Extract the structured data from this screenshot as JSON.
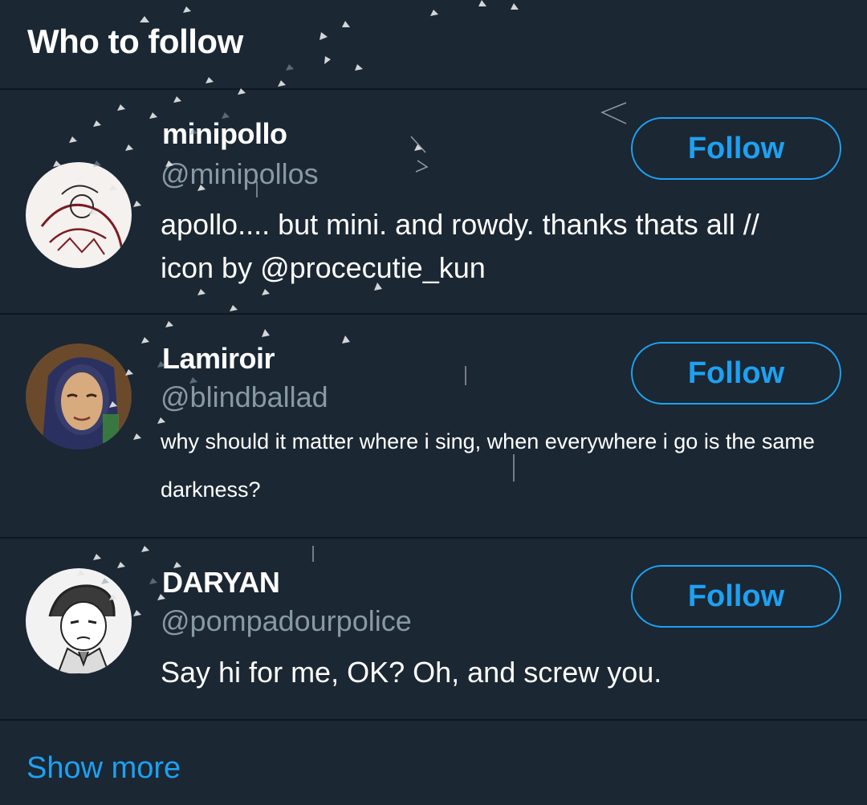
{
  "header": {
    "title": "Who to follow"
  },
  "accounts": [
    {
      "name": "minipollo",
      "handle": "@minipollos",
      "bio": "apollo.... but mini. and rowdy. thanks thats all // icon by @procecutie_kun",
      "follow_label": "Follow"
    },
    {
      "name": "Lamiroir",
      "handle": "@blindballad",
      "bio": "why should it matter where i sing, when everywhere i go is the same darkness?",
      "follow_label": "Follow"
    },
    {
      "name": "DARYAN",
      "handle": "@pompadourpolice",
      "bio": "Say hi for me, OK? Oh, and screw you.",
      "follow_label": "Follow"
    }
  ],
  "footer": {
    "show_more_label": "Show more"
  },
  "colors": {
    "background": "#1b2733",
    "divider": "#0f161d",
    "accent": "#1da1f2",
    "secondary_text": "#8899a6",
    "primary_text": "#ffffff"
  }
}
